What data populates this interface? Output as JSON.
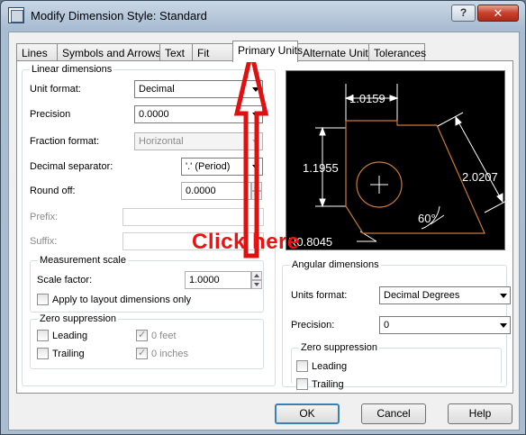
{
  "window": {
    "title": "Modify Dimension Style: Standard",
    "help_label": "?",
    "close_label": "✕",
    "icons": {
      "app": "autocad-app-icon",
      "close": "close-icon",
      "help": "help-icon"
    }
  },
  "tabs": [
    {
      "label": "Lines"
    },
    {
      "label": "Symbols and Arrows"
    },
    {
      "label": "Text"
    },
    {
      "label": "Fit"
    },
    {
      "label": "Primary Units",
      "active": true
    },
    {
      "label": "Alternate Units"
    },
    {
      "label": "Tolerances"
    }
  ],
  "linear": {
    "group_label": "Linear dimensions",
    "unit_format_label": "Unit format:",
    "unit_format_value": "Decimal",
    "precision_label": "Precision",
    "precision_value": "0.0000",
    "fraction_format_label": "Fraction format:",
    "fraction_format_value": "Horizontal",
    "decimal_separator_label": "Decimal separator:",
    "decimal_separator_value": "'.' (Period)",
    "round_off_label": "Round off:",
    "round_off_value": "0.0000",
    "prefix_label": "Prefix:",
    "prefix_value": "",
    "suffix_label": "Suffix:",
    "suffix_value": ""
  },
  "measurement_scale": {
    "group_label": "Measurement scale",
    "scale_factor_label": "Scale factor:",
    "scale_factor_value": "1.0000",
    "apply_layout_label": "Apply to layout dimensions only",
    "apply_layout_checked": false
  },
  "zero_suppression_linear": {
    "group_label": "Zero suppression",
    "leading_label": "Leading",
    "trailing_label": "Trailing",
    "feet_label": "0 feet",
    "inches_label": "0 inches",
    "leading_checked": false,
    "trailing_checked": false,
    "feet_checked": true,
    "inches_checked": true
  },
  "preview": {
    "dim_top": "1.0159",
    "dim_left": "1.1955",
    "dim_right": "2.0207",
    "angle": "60°",
    "radius": "R0.8045"
  },
  "angular": {
    "group_label": "Angular dimensions",
    "units_format_label": "Units format:",
    "units_format_value": "Decimal Degrees",
    "precision_label": "Precision:",
    "precision_value": "0"
  },
  "zero_suppression_angular": {
    "group_label": "Zero suppression",
    "leading_label": "Leading",
    "trailing_label": "Trailing",
    "leading_checked": false,
    "trailing_checked": false
  },
  "annotation": {
    "text": "Click here",
    "color": "#e01010"
  },
  "buttons": {
    "ok": "OK",
    "cancel": "Cancel",
    "help": "Help"
  },
  "colors": {
    "preview_bg": "#000000",
    "preview_lines": "#ffffff",
    "preview_shape": "#c87a3a"
  }
}
